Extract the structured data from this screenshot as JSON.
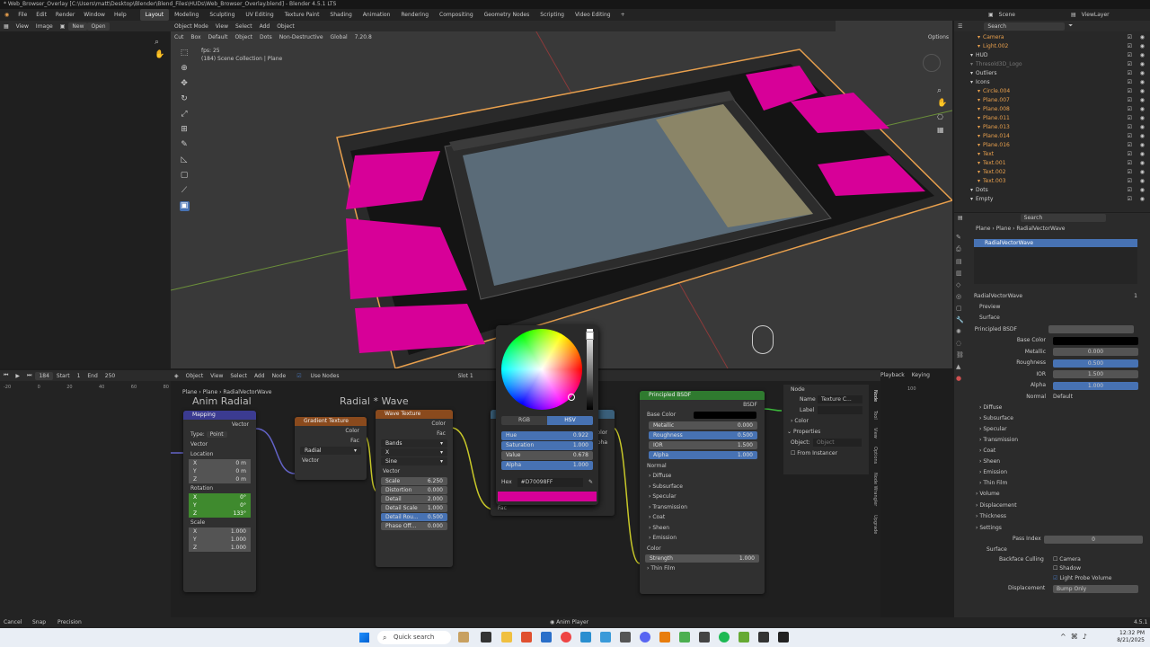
{
  "window": {
    "title": "* Web_Browser_Overlay [C:\\Users\\matt\\Desktop\\Blender\\Blend_Files\\HUDs\\Web_Browser_Overlay.blend] - Blender 4.5.1 LTS"
  },
  "menu": [
    "File",
    "Edit",
    "Render",
    "Window",
    "Help"
  ],
  "workspaces": [
    "Layout",
    "Modeling",
    "Sculpting",
    "UV Editing",
    "Texture Paint",
    "Shading",
    "Animation",
    "Rendering",
    "Compositing",
    "Geometry Nodes",
    "Scripting",
    "Video Editing"
  ],
  "active_workspace": "Layout",
  "scene": {
    "label": "Scene",
    "viewlayer": "ViewLayer"
  },
  "image_editor": {
    "view": "View",
    "image": "Image",
    "new": "New",
    "open": "Open"
  },
  "viewport": {
    "mode": "Object Mode",
    "view": "View",
    "select": "Select",
    "add": "Add",
    "object": "Object",
    "cut": "Cut",
    "box": "Box",
    "default": "Default",
    "object2": "Object",
    "dots": "Dots",
    "non_destructive": "Non-Destructive",
    "global": "Global",
    "version": "7.20.8",
    "options": "Options",
    "fps": "fps: 25",
    "collection": "(184) Scene Collection | Plane"
  },
  "outliner": {
    "search_placeholder": "Search",
    "items": [
      {
        "name": "Camera",
        "color": "#e9a04d",
        "indent": 1
      },
      {
        "name": "Light.002",
        "color": "#e9a04d",
        "indent": 1
      },
      {
        "name": "HUD",
        "color": "#cccccc",
        "indent": 0
      },
      {
        "name": "Thresold3D_Logo",
        "color": "#777777",
        "indent": 0
      },
      {
        "name": "Outliers",
        "color": "#cccccc",
        "indent": 0
      },
      {
        "name": "Icons",
        "color": "#cccccc",
        "indent": 0
      },
      {
        "name": "Circle.004",
        "color": "#e9a04d",
        "indent": 1
      },
      {
        "name": "Plane.007",
        "color": "#e9a04d",
        "indent": 1
      },
      {
        "name": "Plane.008",
        "color": "#e9a04d",
        "indent": 1
      },
      {
        "name": "Plane.011",
        "color": "#e9a04d",
        "indent": 1
      },
      {
        "name": "Plane.013",
        "color": "#e9a04d",
        "indent": 1
      },
      {
        "name": "Plane.014",
        "color": "#e9a04d",
        "indent": 1
      },
      {
        "name": "Plane.016",
        "color": "#e9a04d",
        "indent": 1
      },
      {
        "name": "Text",
        "color": "#e9a04d",
        "indent": 1
      },
      {
        "name": "Text.001",
        "color": "#e9a04d",
        "indent": 1
      },
      {
        "name": "Text.002",
        "color": "#e9a04d",
        "indent": 1
      },
      {
        "name": "Text.003",
        "color": "#e9a04d",
        "indent": 1
      },
      {
        "name": "Dots",
        "color": "#cccccc",
        "indent": 0
      },
      {
        "name": "Empty",
        "color": "#cccccc",
        "indent": 0
      }
    ]
  },
  "properties": {
    "search_placeholder": "Search",
    "breadcrumb": [
      "Plane",
      "Plane",
      "RadialVectorWave"
    ],
    "slot": "RadialVectorWave",
    "material": "RadialVectorWave",
    "users": "1",
    "sections": {
      "preview": "Preview",
      "surface": "Surface"
    },
    "surface": "Principled BSDF",
    "rows": [
      {
        "label": "Base Color",
        "value": "",
        "kind": "color"
      },
      {
        "label": "Metallic",
        "value": "0.000",
        "kind": "num"
      },
      {
        "label": "Roughness",
        "value": "0.500",
        "kind": "blue"
      },
      {
        "label": "IOR",
        "value": "1.500",
        "kind": "num"
      },
      {
        "label": "Alpha",
        "value": "1.000",
        "kind": "blue"
      },
      {
        "label": "Normal",
        "value": "Default",
        "kind": "text"
      }
    ],
    "subs": [
      "Diffuse",
      "Subsurface",
      "Specular",
      "Transmission",
      "Coat",
      "Sheen",
      "Emission",
      "Thin Film"
    ],
    "more": [
      "Volume",
      "Displacement",
      "Thickness",
      "Settings"
    ],
    "pass_index": {
      "label": "Pass Index",
      "value": "0"
    },
    "surface2": "Surface",
    "backface": {
      "label": "Backface Culling",
      "camera": "Camera",
      "shadow": "Shadow",
      "lightprobe": "Light Probe Volume"
    },
    "displacement": {
      "label": "Displacement",
      "value": "Bump Only"
    }
  },
  "timeline": {
    "playback": "Playback",
    "keying": "Keying",
    "frame": "184",
    "start_label": "Start",
    "start": "1",
    "end_label": "End",
    "end": "250",
    "ticks": [
      "-20",
      "0",
      "20",
      "40",
      "60",
      "80",
      "100"
    ]
  },
  "node_editor": {
    "header": {
      "object": "Object",
      "view": "View",
      "select": "Select",
      "add": "Add",
      "node": "Node",
      "use_nodes": "Use Nodes",
      "slot": "Slot 1"
    },
    "breadcrumb": [
      "Plane",
      "Plane",
      "RadialVectorWave"
    ],
    "frame_label": "Anim Radial",
    "frame_label2": "Radial * Wave",
    "mapping": {
      "title": "Mapping",
      "vector_out": "Vector",
      "type_label": "Type:",
      "type": "Point",
      "vector_in": "Vector",
      "location": "Location",
      "loc": [
        [
          "X",
          "0 m"
        ],
        [
          "Y",
          "0 m"
        ],
        [
          "Z",
          "0 m"
        ]
      ],
      "rotation": "Rotation",
      "rot": [
        [
          "X",
          "0°"
        ],
        [
          "Y",
          "0°"
        ],
        [
          "Z",
          "133°"
        ]
      ],
      "scale": "Scale",
      "scl": [
        [
          "X",
          "1.000"
        ],
        [
          "Y",
          "1.000"
        ],
        [
          "Z",
          "1.000"
        ]
      ]
    },
    "gradient": {
      "title": "Gradient Texture",
      "color": "Color",
      "fac": "Fac",
      "type": "Radial",
      "vector": "Vector"
    },
    "wave": {
      "title": "Wave Texture",
      "color": "Color",
      "fac": "Fac",
      "bands": "Bands",
      "axis": "X",
      "profile": "Sine",
      "vector": "Vector",
      "fields": [
        [
          "Scale",
          "6.250"
        ],
        [
          "Distortion",
          "0.000"
        ],
        [
          "Detail",
          "2.000"
        ],
        [
          "Detail Scale",
          "1.000"
        ],
        [
          "Detail Rou...",
          "0.500"
        ],
        [
          "Phase Off...",
          "0.000"
        ]
      ]
    },
    "mix": {
      "fac": "Fac",
      "color": "olor",
      "alpha": "pha"
    },
    "bsdf": {
      "title": "Principled BSDF",
      "out": "BSDF",
      "base_color": "Base Color",
      "fields": [
        [
          "Metallic",
          "0.000"
        ],
        [
          "Roughness",
          "0.500"
        ],
        [
          "IOR",
          "1.500"
        ],
        [
          "Alpha",
          "1.000"
        ]
      ],
      "normal": "Normal",
      "subs": [
        "Diffuse",
        "Subsurface",
        "Specular",
        "Transmission",
        "Coat",
        "Sheen",
        "Emission"
      ],
      "color": "Color",
      "strength": [
        "Strength",
        "1.000"
      ],
      "thin": "Thin Film"
    },
    "side": {
      "node": "Node",
      "name_label": "Name",
      "name": "Texture C...",
      "label_label": "Label",
      "color": "Color",
      "properties": "Properties",
      "object_label": "Object:",
      "object_placeholder": "Object",
      "from_instancer": "From Instancer"
    },
    "tabs": [
      "Node",
      "Tool",
      "View",
      "Options",
      "Node Wrangler",
      "Upgrade"
    ]
  },
  "color_picker": {
    "rgb": "RGB",
    "hsv": "HSV",
    "fields": [
      [
        "Hue",
        "0.922"
      ],
      [
        "Saturation",
        "1.000"
      ],
      [
        "Value",
        "0.678"
      ],
      [
        "Alpha",
        "1.000"
      ]
    ],
    "hex_label": "Hex",
    "hex": "#D70098FF",
    "swatch": "#d70098"
  },
  "status": {
    "cancel": "Cancel",
    "snap": "Snap",
    "precision": "Precision",
    "anim": "Anim Player",
    "version": "4.5.1"
  },
  "taskbar": {
    "search": "Quick search",
    "time": "12:32 PM",
    "date": "8/21/2025"
  },
  "colors": {
    "accent": "#4772b3",
    "magenta": "#d70098",
    "orange": "#e9a04d"
  }
}
